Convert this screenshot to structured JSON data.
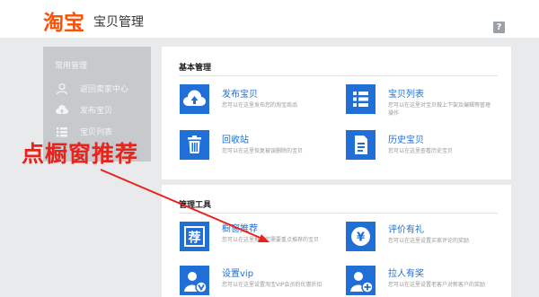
{
  "header": {
    "logo_text": "淘宝",
    "title": "宝贝管理",
    "help_label": "?"
  },
  "sidebar": {
    "title": "常用管理",
    "items": [
      {
        "label": "返回卖家中心",
        "icon": "user-icon"
      },
      {
        "label": "发布宝贝",
        "icon": "upload-cloud-icon"
      },
      {
        "label": "宝贝列表",
        "icon": "list-icon"
      }
    ]
  },
  "basic": {
    "title": "基本管理",
    "tiles": [
      {
        "title": "发布宝贝",
        "desc": "您可以在这里发布您的淘宝商品",
        "icon": "upload-cloud-icon"
      },
      {
        "title": "宝贝列表",
        "desc": "您可以在这里对宝贝做上下架及编辑等管理操作",
        "icon": "list-icon"
      },
      {
        "title": "回收站",
        "desc": "您可以在这里恢复被误删除的宝贝",
        "icon": "trash-icon"
      },
      {
        "title": "历史宝贝",
        "desc": "您可以在这里查看历史宝贝",
        "icon": "document-icon"
      }
    ]
  },
  "tools": {
    "title": "管理工具",
    "tiles": [
      {
        "title": "橱窗推荐",
        "desc": "您可以在这里推荐您需要重点推荐的宝贝",
        "icon": "recommend-icon",
        "glyph": "荐"
      },
      {
        "title": "评价有礼",
        "desc": "您可以在这里设置买家评论的奖励",
        "icon": "yen-icon",
        "glyph": "¥"
      },
      {
        "title": "设置vip",
        "desc": "您可以在这里设置淘宝VIP会员的优惠折扣",
        "icon": "vip-user-icon"
      },
      {
        "title": "拉人有奖",
        "desc": "您可以在这里设置老客户对新客户的奖励",
        "icon": "add-user-icon"
      }
    ]
  },
  "annotation": {
    "text": "点橱窗推荐"
  },
  "colors": {
    "accent": "#1f6fd6",
    "brand": "#ff5000",
    "annotation": "#e8231b"
  }
}
